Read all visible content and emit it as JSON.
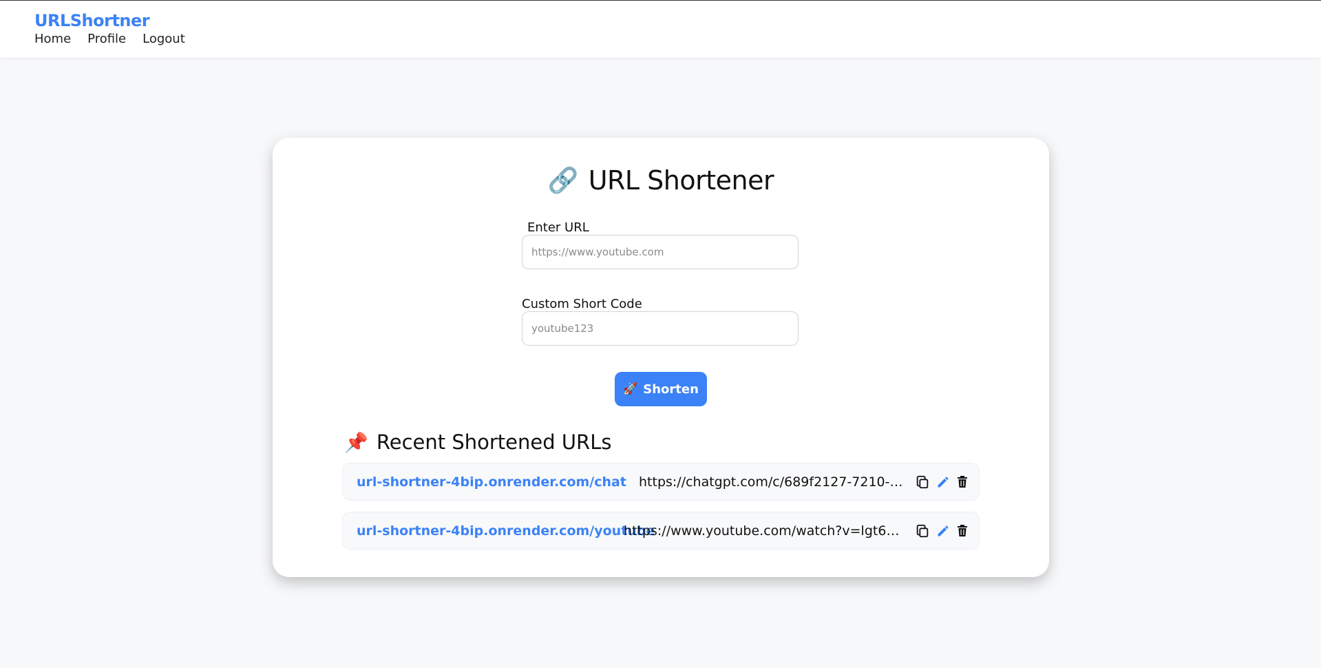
{
  "navbar": {
    "brand": "URLShortner",
    "links": [
      "Home",
      "Profile",
      "Logout"
    ]
  },
  "card": {
    "title_icon": "link-icon",
    "title": "URL Shortener",
    "url_field": {
      "label": "Enter URL",
      "placeholder": "https://www.youtube.com",
      "value": ""
    },
    "code_field": {
      "label": "Custom Short Code",
      "placeholder": "youtube123",
      "value": ""
    },
    "shorten_button": {
      "icon": "rocket-icon",
      "label": "Shorten"
    },
    "recent": {
      "icon": "pushpin-icon",
      "title": "Recent Shortened URLs",
      "items": [
        {
          "short_url": "url-shortner-4bip.onrender.com/chat",
          "original_url": "https://chatgpt.com/c/689f2127-7210-832d…"
        },
        {
          "short_url": "url-shortner-4bip.onrender.com/youtube",
          "original_url": "https://www.youtube.com/watch?v=lgt66hvT…"
        }
      ]
    }
  },
  "colors": {
    "accent": "#3b82f6",
    "background": "#f7f8fa",
    "card": "#ffffff",
    "delete_icon": "#111111"
  }
}
